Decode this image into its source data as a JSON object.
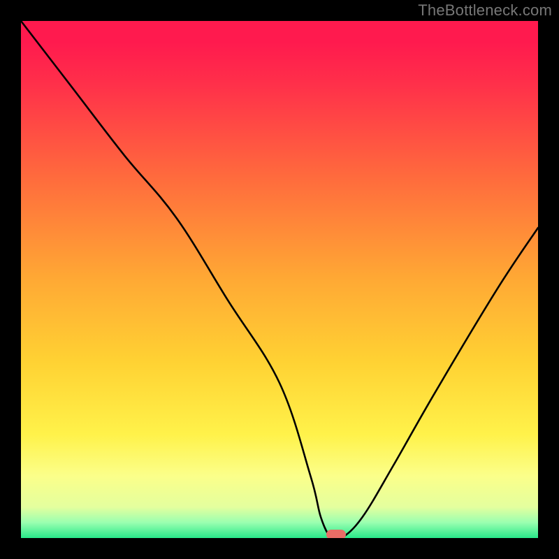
{
  "watermark": "TheBottleneck.com",
  "colors": {
    "bg": "#000000",
    "curve": "#000000",
    "marker": "#e96d66",
    "gradient_top": "#ff1a4e",
    "gradient_bottom": "#28e88a"
  },
  "chart_data": {
    "type": "line",
    "title": "",
    "xlabel": "",
    "ylabel": "",
    "xlim": [
      0,
      100
    ],
    "ylim": [
      0,
      100
    ],
    "grid": false,
    "series": [
      {
        "name": "bottleneck-curve",
        "x": [
          0,
          10,
          20,
          30,
          40,
          50,
          56,
          58,
          60,
          62,
          66,
          72,
          80,
          92,
          100
        ],
        "values": [
          100,
          87,
          74,
          62,
          46,
          30,
          12,
          4,
          0,
          0,
          4,
          14,
          28,
          48,
          60
        ]
      }
    ],
    "annotations": [
      {
        "name": "optimum-marker",
        "x": 61,
        "y": 0,
        "shape": "pill"
      }
    ],
    "minimum_x": 61
  }
}
